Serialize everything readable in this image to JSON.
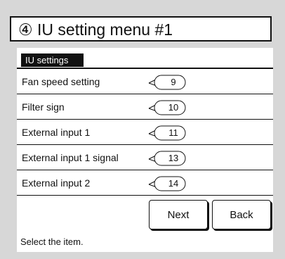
{
  "title": "④ IU setting menu #1",
  "tab_label": "IU settings",
  "items": [
    {
      "label": "Fan speed setting",
      "callout": "9"
    },
    {
      "label": "Filter sign",
      "callout": "10"
    },
    {
      "label": "External input 1",
      "callout": "11"
    },
    {
      "label": "External input 1 signal",
      "callout": "13"
    },
    {
      "label": "External input 2",
      "callout": "14"
    }
  ],
  "buttons": {
    "next": "Next",
    "back": "Back"
  },
  "status_text": "Select the item."
}
